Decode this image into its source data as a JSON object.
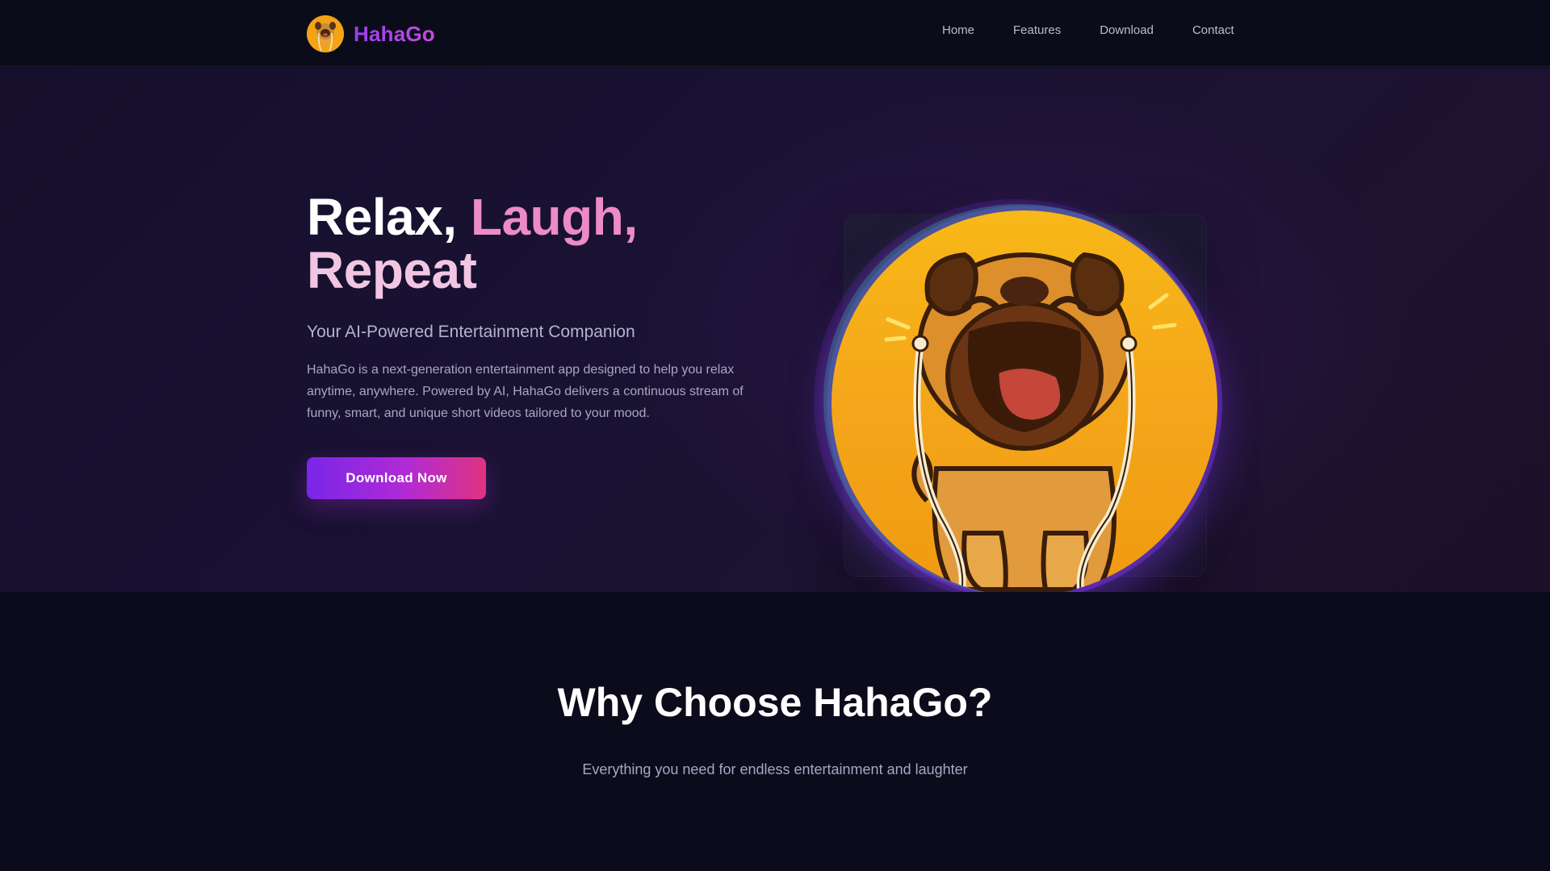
{
  "header": {
    "brand_name": "HahaGo",
    "nav": [
      {
        "label": "Home"
      },
      {
        "label": "Features"
      },
      {
        "label": "Download"
      },
      {
        "label": "Contact"
      }
    ]
  },
  "hero": {
    "title_part1": "Relax, ",
    "title_part2": "Laugh,",
    "title_part3": "Repeat",
    "subtitle": "Your AI-Powered Entertainment Companion",
    "description": "HahaGo is a next-generation entertainment app designed to help you relax anytime, anywhere. Powered by AI, HahaGo delivers a continuous stream of funny, smart, and unique short videos tailored to your mood.",
    "cta_label": "Download Now",
    "illustration": "laughing-pug-with-earphones"
  },
  "features": {
    "title": "Why Choose HahaGo?",
    "subtitle": "Everything you need for endless entertainment and laughter"
  },
  "colors": {
    "background": "#0b0b1c",
    "hero_background": "#1a1233",
    "brand_purple": "#9b3df0",
    "accent_pink": "#ec8bc7",
    "cta_start": "#7a26e8",
    "cta_end": "#e0337f",
    "mascot_orange": "#f4a61a"
  }
}
